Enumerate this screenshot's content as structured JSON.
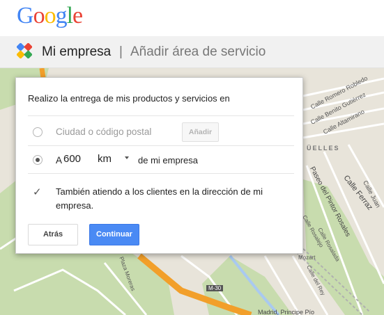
{
  "logo": {
    "letters": [
      "G",
      "o",
      "o",
      "g",
      "l",
      "e"
    ],
    "colors": [
      "#4285f4",
      "#ea4335",
      "#fbbc05",
      "#4285f4",
      "#34a853",
      "#ea4335"
    ]
  },
  "titlebar": {
    "title": "Mi empresa",
    "separator": "|",
    "subtitle": "Añadir área de servicio"
  },
  "dialog": {
    "heading": "Realizo la entrega de mis productos y servicios en",
    "option_city": {
      "label": "Ciudad o código postal",
      "add_button": "Añadir",
      "selected": false
    },
    "option_distance": {
      "prefix": "A",
      "value": "600",
      "unit": "km",
      "suffix": "de mi empresa",
      "selected": true
    },
    "checkbox": {
      "checked": true,
      "label": "También atiendo a los clientes en la dirección de mi empresa."
    },
    "back_button": "Atrás",
    "continue_button": "Continuar"
  },
  "map": {
    "labels": [
      "Calle Romero Robledo",
      "Calle Benito Gutiérrez",
      "Calle Altamirano",
      "ÜELLES",
      "Paseo del Pintor Rosales",
      "Calle Ferraz",
      "Calle Juan",
      "Calle Rosalejo",
      "Calle Rosalada",
      "Calle del Rey",
      "Mozart",
      "Plaza Moreras",
      "M-30",
      "Madrid, Principe Pío"
    ]
  }
}
